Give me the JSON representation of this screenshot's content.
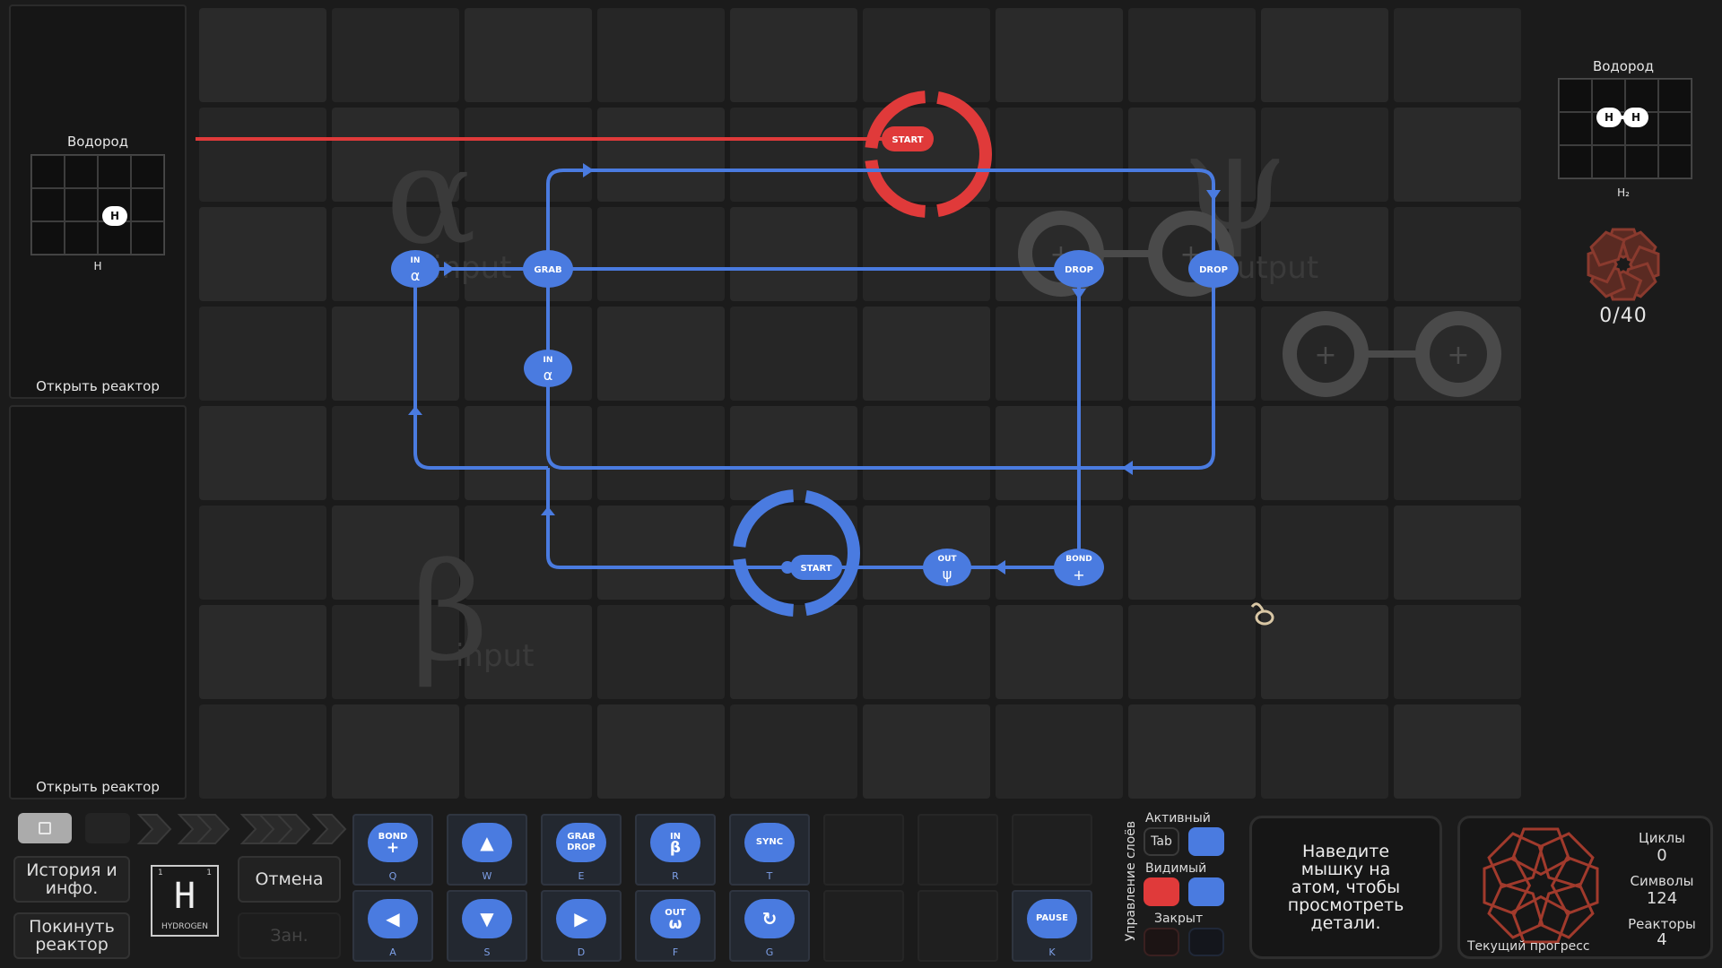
{
  "left_panels": [
    {
      "molecule_name": "Водород",
      "formula": "H",
      "atom": "H",
      "open_label": "Открыть реактор"
    },
    {
      "open_label": "Открыть реактор"
    }
  ],
  "output_panel": {
    "molecule_name": "Водород",
    "formula": "H₂",
    "atoms": [
      "H",
      "H"
    ],
    "progress": "0/40"
  },
  "board": {
    "labels": {
      "alpha": "α",
      "alpha_sub": "input",
      "beta": "β",
      "beta_sub": "input",
      "psi": "ψ",
      "psi_sub": "output"
    },
    "red_nodes": [
      {
        "text": "START"
      }
    ],
    "blue_nodes": [
      {
        "text": "IN",
        "sub": "α"
      },
      {
        "text": "GRAB"
      },
      {
        "text": "IN",
        "sub": "α"
      },
      {
        "text": "DROP"
      },
      {
        "text": "DROP"
      },
      {
        "text": "START"
      },
      {
        "text": "OUT",
        "sub": "ψ"
      },
      {
        "text": "BOND",
        "sub": "+"
      }
    ]
  },
  "controls": {
    "history_label": "История и инфо.",
    "exit_label": "Покинуть реактор",
    "undo_label": "Отмена",
    "busy_label": "Зан.",
    "element_symbol": "H",
    "element_name": "HYDROGEN",
    "element_number": "1",
    "element_mass": "1"
  },
  "toolbar": {
    "top": [
      {
        "label": "BOND",
        "sub": "+",
        "key": "Q"
      },
      {
        "label": "▲",
        "sub": "",
        "key": "W"
      },
      {
        "label": "GRAB",
        "sub": "DROP",
        "key": "E"
      },
      {
        "label": "IN",
        "sub": "β",
        "key": "R"
      },
      {
        "label": "SYNC",
        "sub": "",
        "key": "T"
      }
    ],
    "bottom": [
      {
        "label": "◀",
        "sub": "",
        "key": "A"
      },
      {
        "label": "▼",
        "sub": "",
        "key": "S"
      },
      {
        "label": "▶",
        "sub": "",
        "key": "D"
      },
      {
        "label": "OUT",
        "sub": "ω",
        "key": "F"
      },
      {
        "label": "↻",
        "sub": "",
        "key": "G"
      }
    ],
    "pause": {
      "label": "PAUSE",
      "key": "K"
    }
  },
  "layers": {
    "title": "Управление слоёв",
    "active_label": "Активный",
    "tab_label": "Tab",
    "visible_label": "Видимый",
    "locked_label": "Закрыт",
    "colors": {
      "red": "#e03a3a",
      "blue": "#4a7be0"
    }
  },
  "hint": "Наведите мышку на атом, чтобы просмотреть детали.",
  "stats": {
    "cycles_label": "Циклы",
    "cycles_value": "0",
    "symbols_label": "Символы",
    "symbols_value": "124",
    "reactors_label": "Реакторы",
    "reactors_value": "4",
    "progress_label": "Текущий прогресс"
  }
}
